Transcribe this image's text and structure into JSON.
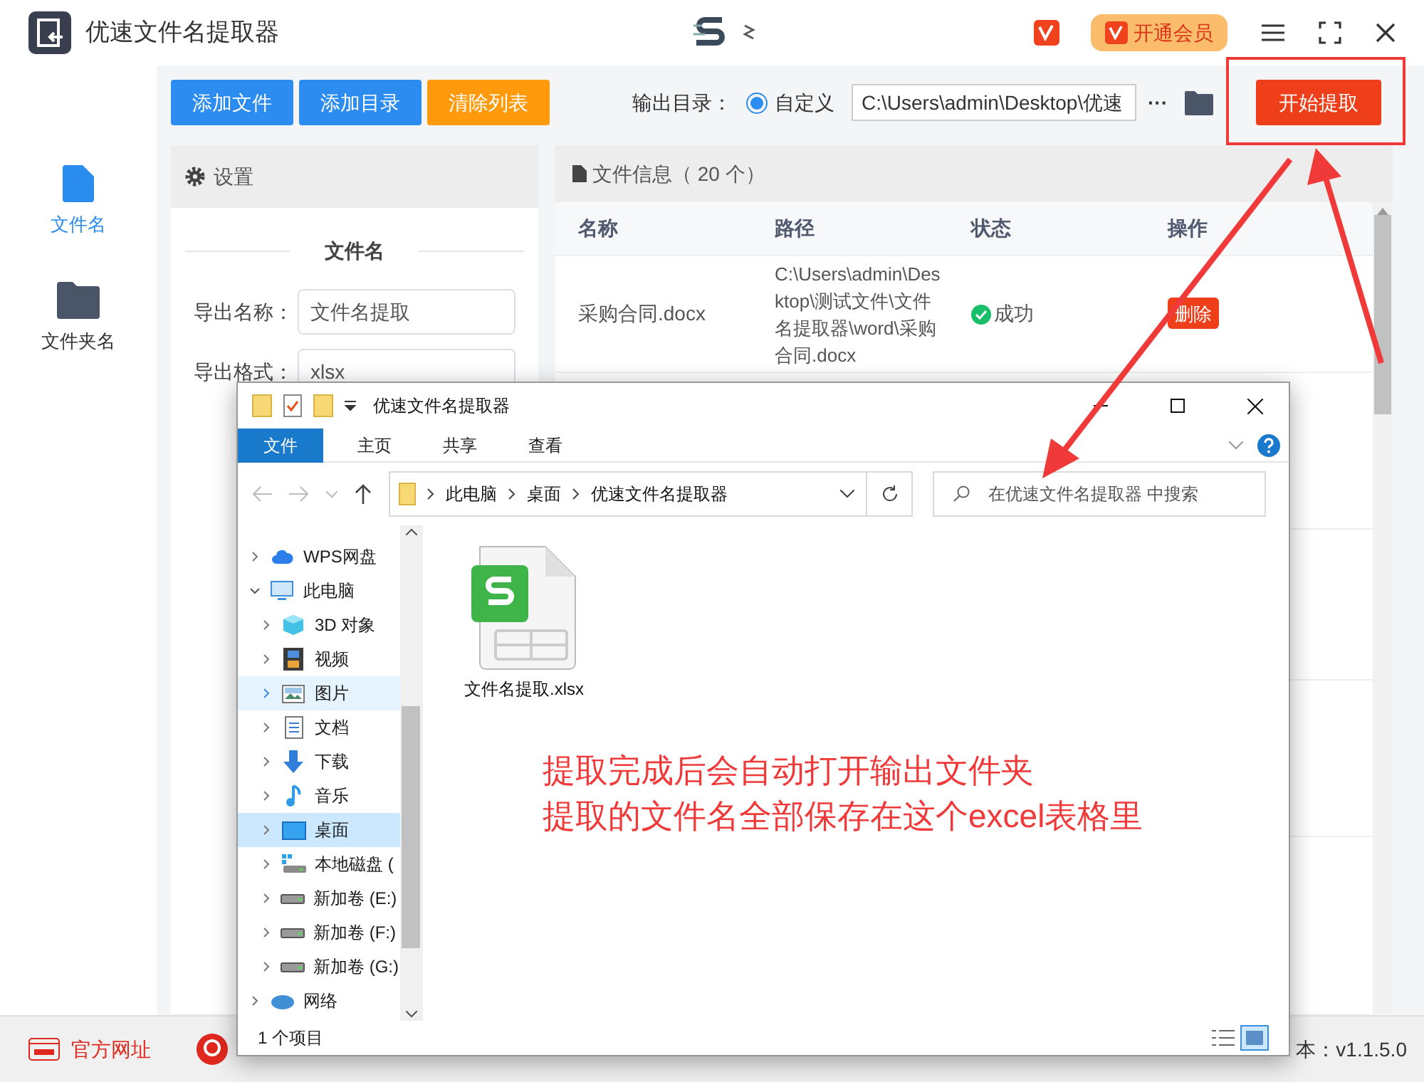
{
  "app": {
    "title": "优速文件名提取器",
    "vip_button": "开通会员"
  },
  "sidebar": {
    "items": [
      {
        "label": "文件名",
        "kind": "file",
        "selected": true
      },
      {
        "label": "文件夹名",
        "kind": "folder",
        "selected": false
      }
    ]
  },
  "toolbar": {
    "buttons": [
      {
        "label": "添加文件",
        "kind": "primary"
      },
      {
        "label": "添加目录",
        "kind": "primary"
      },
      {
        "label": "清除列表",
        "kind": "warning"
      }
    ],
    "output_label": "输出目录：",
    "radio": {
      "label": "自定义",
      "selected": true
    },
    "path": "C:\\Users\\admin\\Desktop\\优速",
    "more": "···",
    "start_button": "开始提取"
  },
  "settings": {
    "title": "设置",
    "section": "文件名",
    "fields": [
      {
        "label": "导出名称：",
        "value": "文件名提取"
      },
      {
        "label": "导出格式：",
        "value": "xlsx"
      }
    ]
  },
  "files": {
    "title": "文件信息（ 20 个）",
    "columns": [
      "名称",
      "路径",
      "状态",
      "操作"
    ],
    "rows": [
      {
        "name": "采购合同.docx",
        "path": "C:\\Users\\admin\\Desktop\\测试文件\\文件名提取器\\word\\采购合同.docx",
        "status": "成功",
        "kind": "success",
        "action": "删除"
      }
    ]
  },
  "explorer": {
    "title": "优速文件名提取器",
    "tabs": [
      {
        "label": "文件",
        "selected": true
      },
      {
        "label": "主页",
        "selected": false
      },
      {
        "label": "共享",
        "selected": false
      },
      {
        "label": "查看",
        "selected": false
      }
    ],
    "breadcrumbs": [
      "此电脑",
      "桌面",
      "优速文件名提取器"
    ],
    "search_placeholder": "在优速文件名提取器 中搜索",
    "nav": [
      {
        "label": "WPS网盘",
        "kind": "cloud",
        "expanded": false,
        "selected": false,
        "highlighted": false
      },
      {
        "label": "此电脑",
        "kind": "pc",
        "expanded": true,
        "selected": false,
        "highlighted": false,
        "children": [
          {
            "label": "3D 对象",
            "kind": "cube",
            "expanded": false,
            "selected": false,
            "highlighted": false
          },
          {
            "label": "视频",
            "kind": "video",
            "expanded": false,
            "selected": false,
            "highlighted": false
          },
          {
            "label": "图片",
            "kind": "image",
            "expanded": false,
            "selected": false,
            "highlighted": true
          },
          {
            "label": "文档",
            "kind": "doc",
            "expanded": false,
            "selected": false,
            "highlighted": false
          },
          {
            "label": "下载",
            "kind": "download",
            "expanded": false,
            "selected": false,
            "highlighted": false
          },
          {
            "label": "音乐",
            "kind": "music",
            "expanded": false,
            "selected": false,
            "highlighted": false
          },
          {
            "label": "桌面",
            "kind": "desktop",
            "expanded": false,
            "selected": true,
            "highlighted": false
          },
          {
            "label": "本地磁盘 (",
            "kind": "disk",
            "expanded": false,
            "selected": false,
            "highlighted": false
          },
          {
            "label": "新加卷 (E:)",
            "kind": "drive",
            "expanded": false,
            "selected": false,
            "highlighted": false
          },
          {
            "label": "新加卷 (F:)",
            "kind": "drive",
            "expanded": false,
            "selected": false,
            "highlighted": false
          },
          {
            "label": "新加卷 (G:)",
            "kind": "drive",
            "expanded": false,
            "selected": false,
            "highlighted": false
          }
        ]
      },
      {
        "label": "网络",
        "kind": "network",
        "expanded": false,
        "selected": false,
        "highlighted": false
      }
    ],
    "file": {
      "name": "文件名提取.xlsx"
    },
    "status": "1 个项目"
  },
  "annotation": [
    "提取完成后会自动打开输出文件夹",
    "提取的文件名全部保存在这个excel表格里"
  ],
  "footer": {
    "link": "官方网址",
    "version": "本：v1.1.5.0"
  }
}
